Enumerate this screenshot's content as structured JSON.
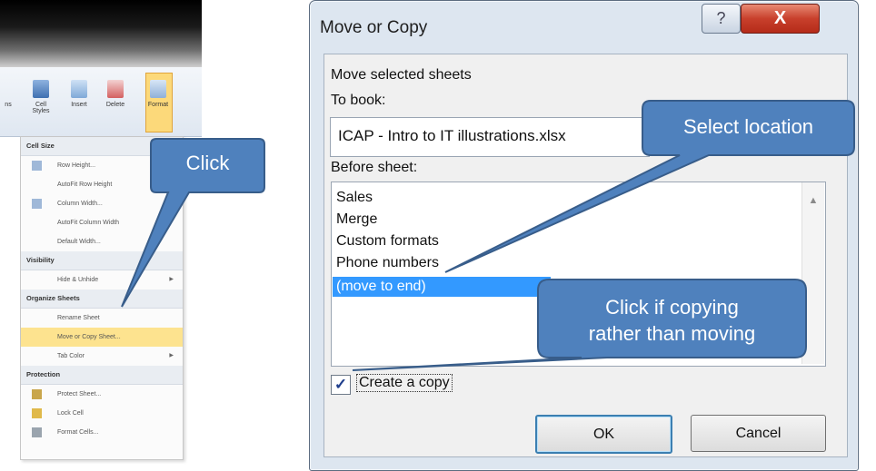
{
  "ribbon": {
    "buttons": [
      {
        "label": "ns"
      },
      {
        "label": "Cell Styles"
      },
      {
        "label": "Insert"
      },
      {
        "label": "Delete"
      },
      {
        "label": "Format"
      }
    ]
  },
  "format_menu": {
    "sections": {
      "cell_size": "Cell Size",
      "visibility": "Visibility",
      "organize": "Organize Sheets",
      "protection": "Protection"
    },
    "items": {
      "row_height": "Row Height...",
      "autofit_row": "AutoFit Row Height",
      "column_width": "Column Width...",
      "autofit_column": "AutoFit Column Width",
      "default_width": "Default Width...",
      "hide_unhide": "Hide & Unhide",
      "rename_sheet": "Rename Sheet",
      "move_copy": "Move or Copy Sheet...",
      "tab_color": "Tab Color",
      "protect_sheet": "Protect Sheet...",
      "lock_cell": "Lock Cell",
      "format_cells": "Format Cells..."
    }
  },
  "dialog": {
    "title": "Move or Copy",
    "help_label": "?",
    "close_label": "X",
    "move_selected_label": "Move selected sheets",
    "to_book_label": "To book:",
    "to_book_value": "ICAP - Intro to IT illustrations.xlsx",
    "before_sheet_label": "Before sheet:",
    "sheets": [
      "Sales",
      "Merge",
      "Custom formats",
      "Phone numbers",
      "(move to end)"
    ],
    "selected_index": 4,
    "create_copy_label": "Create a copy",
    "create_copy_checked": true,
    "ok_label": "OK",
    "cancel_label": "Cancel"
  },
  "callouts": {
    "click": "Click",
    "select_location": "Select location",
    "copy_line1": "Click if copying",
    "copy_line2": "rather than moving",
    "fill_color": "#4f81bd",
    "stroke_color": "#385d8a"
  }
}
